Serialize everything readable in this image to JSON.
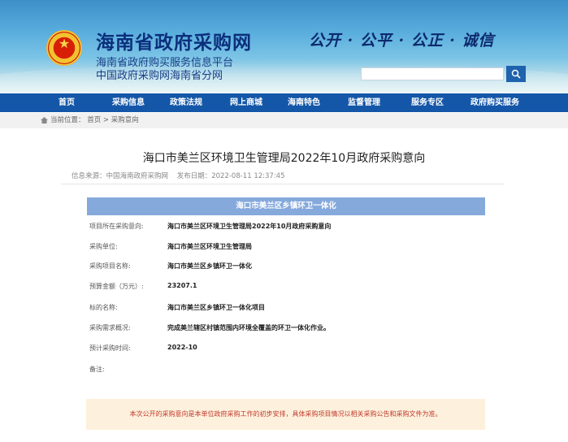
{
  "header": {
    "site_title": "海南省政府采购网",
    "subtitle_line1": "海南省政府购买服务信息平台",
    "subtitle_line2": "中国政府采购网海南省分网",
    "slogan": "公开 · 公平 · 公正 · 诚信",
    "search": {
      "value": "",
      "placeholder": ""
    }
  },
  "nav": {
    "items": [
      "首页",
      "采购信息",
      "政策法规",
      "网上商城",
      "海南特色",
      "监督管理",
      "服务专区",
      "政府购买服务"
    ]
  },
  "breadcrumb": {
    "text": "当前位置： 首页 > 采购意向"
  },
  "article": {
    "title": "海口市美兰区环境卫生管理局2022年10月政府采购意向",
    "source": "信息来源：中国海南政府采购网",
    "date": "发布日期：2022-08-11 12:37:45"
  },
  "project": {
    "header": "海口市美兰区乡镇环卫一体化",
    "rows": [
      {
        "label": "项目所在采购意向:",
        "value": "海口市美兰区环境卫生管理局2022年10月政府采购意向"
      },
      {
        "label": "采购单位:",
        "value": "海口市美兰区环境卫生管理局"
      },
      {
        "label": "采购项目名称:",
        "value": "海口市美兰区乡镇环卫一体化"
      },
      {
        "label": "预算金额（万元）:",
        "value": "23207.1"
      },
      {
        "label": "标的名称:",
        "value": "海口市美兰区乡镇环卫一体化项目"
      },
      {
        "label": "采购需求概况:",
        "value": "完成美兰辖区村镇范围内环境全覆盖的环卫一体化作业。"
      },
      {
        "label": "预计采购时间:",
        "value": "2022-10"
      },
      {
        "label": "备注:",
        "value": ""
      }
    ]
  },
  "notice": "本次公开的采购意向是本单位政府采购工作的初步安排，具体采购项目情况以相关采购公告和采购文件为准。",
  "colors": {
    "nav_bg": "#1457a8",
    "project_header_bg": "#86a9dc",
    "notice_bg": "#fdf1dd",
    "notice_text": "#c0392b"
  },
  "icons": {
    "home": "home-icon",
    "search": "search-icon",
    "emblem": "national-emblem-icon"
  }
}
